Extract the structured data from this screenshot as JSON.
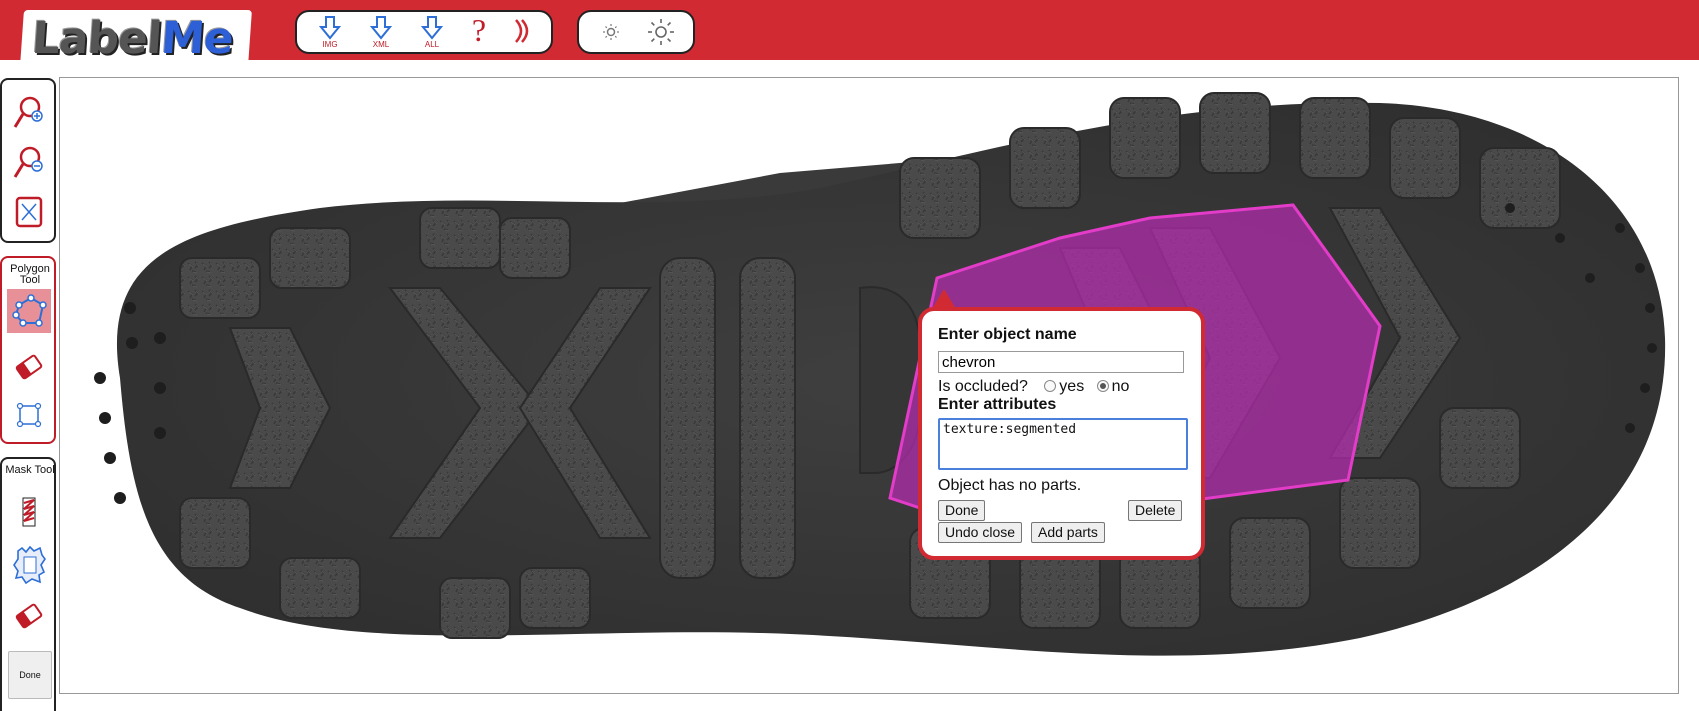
{
  "app": {
    "logo_text_main": "Label",
    "logo_text_accent": "Me"
  },
  "toolbar": {
    "download_img_label": "IMG",
    "download_xml_label": "XML",
    "download_all_label": "ALL",
    "help_label": "?"
  },
  "sidebar": {
    "polygon_tool_label": "Polygon Tool",
    "mask_tool_label": "Mask Tool",
    "done_label": "Done"
  },
  "dialog": {
    "title": "Enter object name",
    "object_name": "chevron",
    "occluded_label": "Is occluded?",
    "occluded_yes": "yes",
    "occluded_no": "no",
    "occluded_value": "no",
    "attributes_label": "Enter attributes",
    "attributes_value": "texture:segmented",
    "parts_status": "Object has no parts.",
    "done_button": "Done",
    "delete_button": "Delete",
    "undo_close_button": "Undo close",
    "add_parts_button": "Add parts"
  },
  "colors": {
    "brand_red": "#d12a33",
    "polygon_stroke": "#e23cc8",
    "polygon_fill": "#b62cb0",
    "focus_blue": "#4a7fdb"
  }
}
